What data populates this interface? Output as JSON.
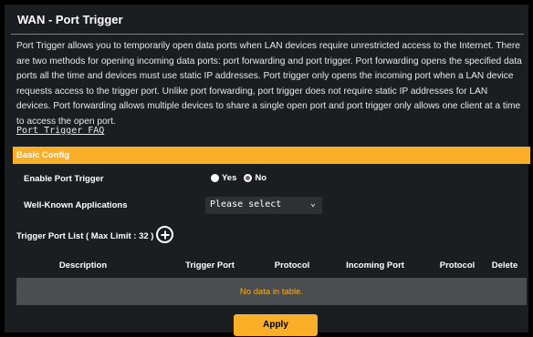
{
  "page": {
    "title": "WAN - Port Trigger",
    "description": "Port Trigger allows you to temporarily open data ports when LAN devices require unrestricted access to the Internet. There are two methods for opening incoming data ports: port forwarding and port trigger. Port forwarding opens the specified data ports all the time and devices must use static IP addresses. Port trigger only opens the incoming port when a LAN device requests access to the trigger port. Unlike port forwarding, port trigger does not require static IP addresses for LAN devices. Port forwarding allows multiple devices to share a single open port and port trigger only allows one client at a time to access the open port.",
    "faq_link": "Port Trigger FAQ"
  },
  "basic_config": {
    "header": "Basic Config",
    "enable_label": "Enable Port Trigger",
    "enable_options": [
      "Yes",
      "No"
    ],
    "enable_selected": "No",
    "apps_label": "Well-Known Applications",
    "apps_value": "Please select"
  },
  "trigger_list": {
    "title": "Trigger Port List ( Max Limit : 32 )",
    "columns": [
      "Description",
      "Trigger Port",
      "Protocol",
      "Incoming Port",
      "Protocol",
      "Delete"
    ],
    "empty_text": "No data in table."
  },
  "actions": {
    "apply_label": "Apply"
  },
  "colors": {
    "accent": "#fbae28",
    "panel_bg": "#1b1e20",
    "empty_row_bg": "#4b4e51"
  },
  "icons": {
    "add": "add-circle-icon",
    "dropdown": "chevron-down-icon"
  }
}
